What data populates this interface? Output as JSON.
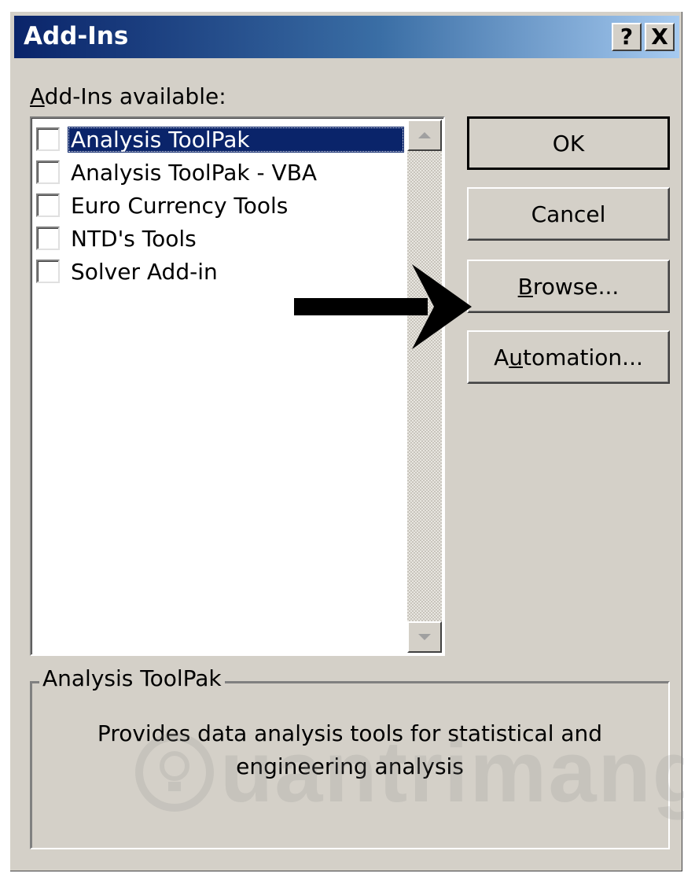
{
  "window": {
    "title": "Add-Ins",
    "help_label": "?",
    "close_label": "X"
  },
  "list": {
    "label_prefix": "A",
    "label_rest": "dd-Ins available:",
    "items": [
      {
        "label": "Analysis ToolPak",
        "checked": false,
        "selected": true
      },
      {
        "label": "Analysis ToolPak - VBA",
        "checked": false,
        "selected": false
      },
      {
        "label": "Euro Currency Tools",
        "checked": false,
        "selected": false
      },
      {
        "label": "NTD's Tools",
        "checked": false,
        "selected": false
      },
      {
        "label": "Solver Add-in",
        "checked": false,
        "selected": false
      }
    ]
  },
  "buttons": {
    "ok": "OK",
    "cancel": "Cancel",
    "browse_mnemonic": "B",
    "browse_rest": "rowse...",
    "automation_pre": "A",
    "automation_mnemonic": "u",
    "automation_rest": "tomation..."
  },
  "description": {
    "group_title": "Analysis ToolPak",
    "text": "Provides data analysis tools for statistical and engineering analysis"
  },
  "watermark": {
    "text": "uantrimang"
  },
  "colors": {
    "dialog_bg": "#d4d0c8",
    "title_start": "#0a246a",
    "title_end": "#a6caf0",
    "selection": "#0a246a"
  },
  "icons": {
    "up_arrow": "scroll-up-icon",
    "down_arrow": "scroll-down-icon",
    "pointer": "arrow-pointer-icon",
    "watermark_logo": "lightbulb-icon"
  }
}
